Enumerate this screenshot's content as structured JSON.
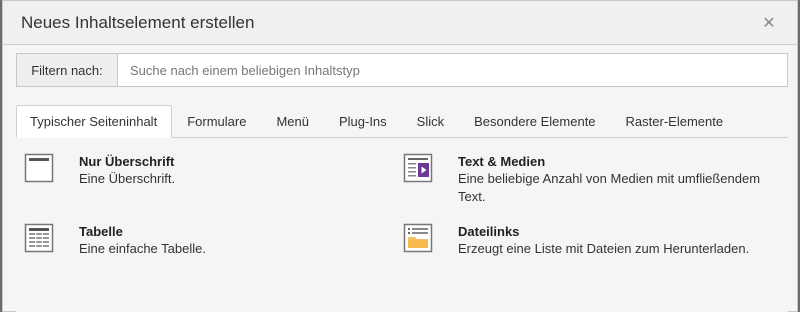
{
  "modal": {
    "title": "Neues Inhaltselement erstellen",
    "close_icon": "close-icon"
  },
  "filter": {
    "label": "Filtern nach:",
    "placeholder": "Suche nach einem beliebigen Inhaltstyp",
    "value": ""
  },
  "tabs": [
    {
      "label": "Typischer Seiteninhalt",
      "active": true
    },
    {
      "label": "Formulare",
      "active": false
    },
    {
      "label": "Menü",
      "active": false
    },
    {
      "label": "Plug-Ins",
      "active": false
    },
    {
      "label": "Slick",
      "active": false
    },
    {
      "label": "Besondere Elemente",
      "active": false
    },
    {
      "label": "Raster-Elemente",
      "active": false
    }
  ],
  "items": [
    {
      "title": "Nur Überschrift",
      "description": "Eine Überschrift.",
      "icon": "header-icon"
    },
    {
      "title": "Text & Medien",
      "description": "Eine beliebige Anzahl von Medien mit umfließendem Text.",
      "icon": "text-media-icon"
    },
    {
      "title": "Tabelle",
      "description": "Eine einfache Tabelle.",
      "icon": "table-icon"
    },
    {
      "title": "Dateilinks",
      "description": "Erzeugt eine Liste mit Dateien zum Herunterladen.",
      "icon": "file-links-icon"
    }
  ],
  "colors": {
    "media_play": "#6b3a96",
    "folder": "#f5c06a"
  }
}
